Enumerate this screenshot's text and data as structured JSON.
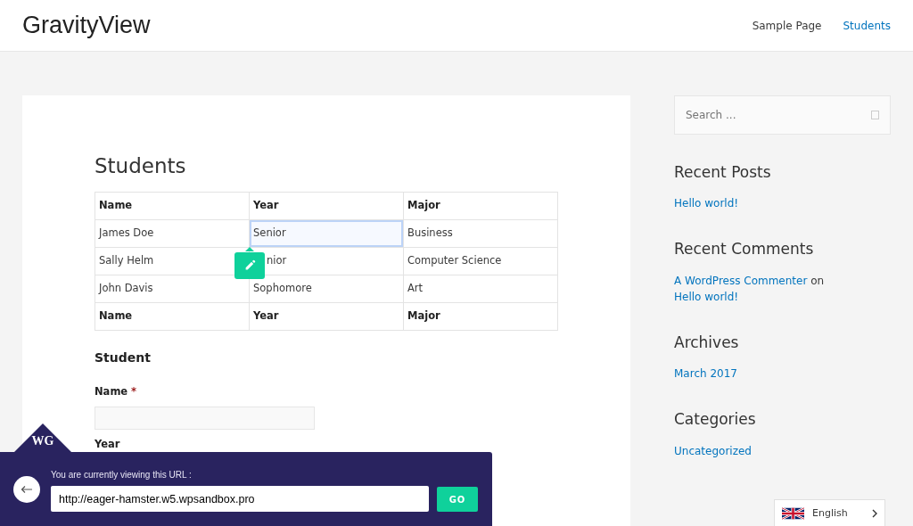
{
  "site": {
    "title": "GravityView"
  },
  "nav": [
    {
      "label": "Sample Page",
      "selected": false
    },
    {
      "label": "Students",
      "selected": true
    }
  ],
  "page_title": "Students",
  "table": {
    "columns": [
      "Name",
      "Year",
      "Major"
    ],
    "rows": [
      [
        {
          "text": "James Doe",
          "selected": false
        },
        {
          "text": "Senior",
          "selected": true
        },
        {
          "text": "Business",
          "selected": false
        }
      ],
      [
        {
          "text": "Sally Helm",
          "selected": false
        },
        {
          "text": "nior",
          "selected": false,
          "covered": true
        },
        {
          "text": "Computer Science",
          "selected": false
        }
      ],
      [
        {
          "text": "John Davis",
          "selected": false
        },
        {
          "text": "Sophomore",
          "selected": false
        },
        {
          "text": "Art",
          "selected": false
        }
      ]
    ],
    "footer": [
      "Name",
      "Year",
      "Major"
    ]
  },
  "form": {
    "title": "Student",
    "fields": [
      {
        "label": "Name",
        "required_mark": "*",
        "kind": "text"
      },
      {
        "label": "Year",
        "kind": "label"
      }
    ]
  },
  "sidebar": {
    "search": {
      "placeholder": "Search ..."
    },
    "widgets": [
      {
        "title": "Recent Posts",
        "items": [
          [
            {
              "text": "Hello world!",
              "link": true
            }
          ]
        ]
      },
      {
        "title": "Recent Comments",
        "items": [
          [
            {
              "text": "A WordPress Commenter",
              "link": true
            },
            {
              "text": "on",
              "link": false
            },
            {
              "text": "Hello world!",
              "link": true
            }
          ]
        ]
      },
      {
        "title": "Archives",
        "items": [
          [
            {
              "text": "March 2017",
              "link": true
            }
          ]
        ]
      },
      {
        "title": "Categories",
        "items": [
          [
            {
              "text": "Uncategorized",
              "link": true
            }
          ]
        ]
      }
    ]
  },
  "url_bar": {
    "logo": "WG",
    "prompt": "You are currently viewing this URL :",
    "value": "http://eager-hamster.w5.wpsandbox.pro",
    "button": "GO"
  },
  "language": {
    "label": "English"
  }
}
